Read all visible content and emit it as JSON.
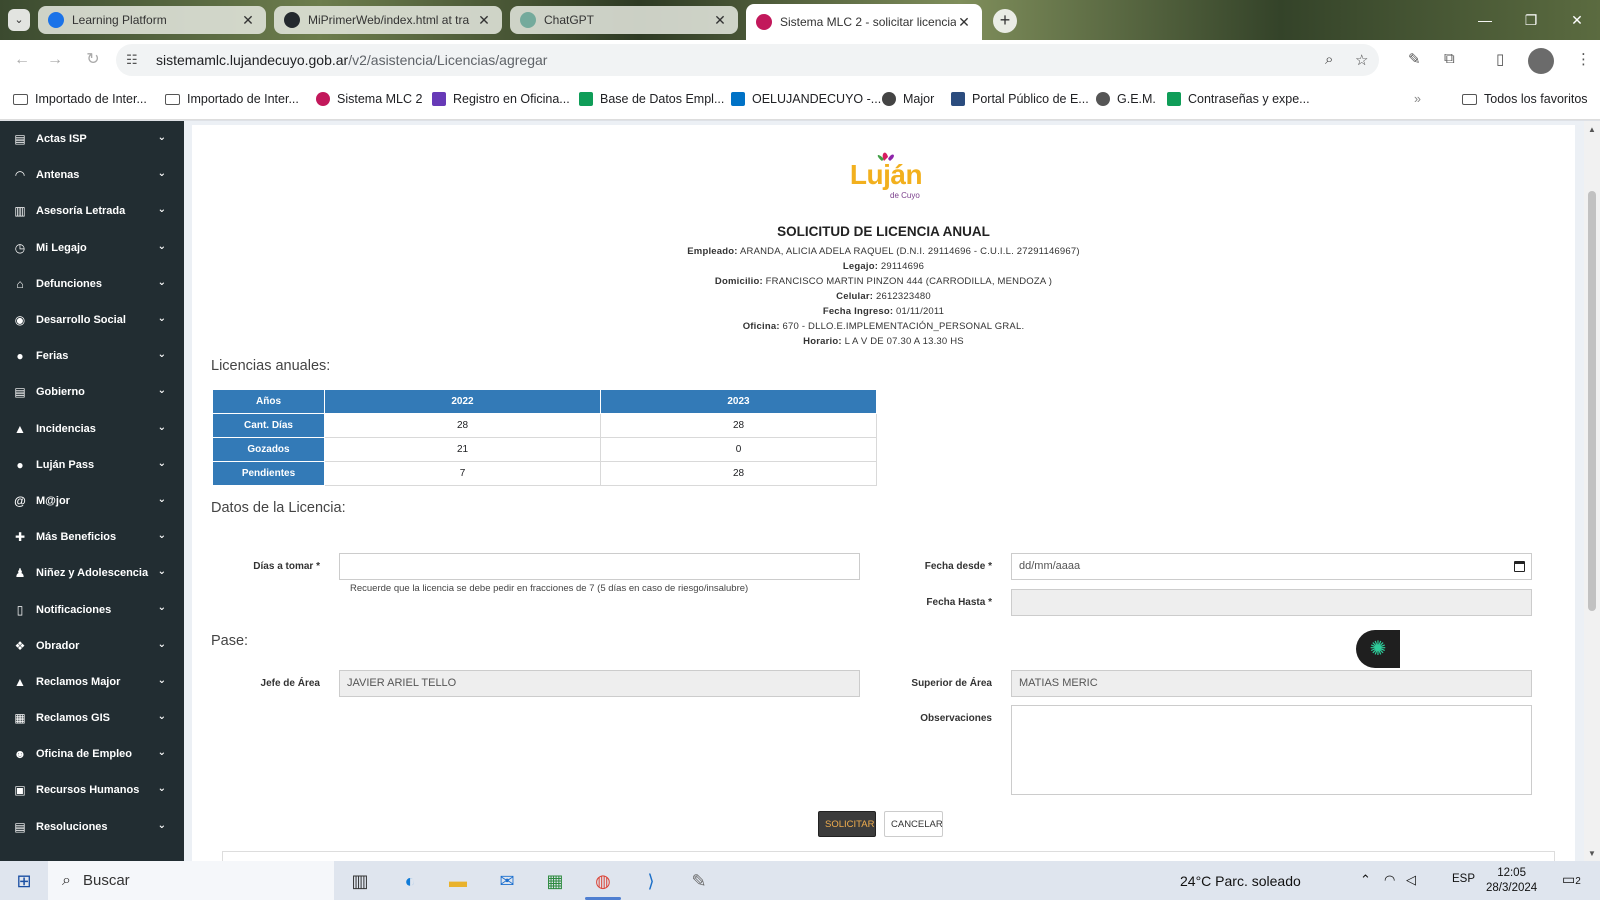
{
  "browser": {
    "tabs": [
      {
        "title": "Learning Platform",
        "color": "#1a73e8"
      },
      {
        "title": "MiPrimerWeb/index.html at tra",
        "color": "#24292e"
      },
      {
        "title": "ChatGPT",
        "color": "#74aa9c"
      },
      {
        "title": "Sistema MLC 2 - solicitar licencia",
        "color": "#c2185b"
      }
    ],
    "url_host": "sistemamlc.lujandecuyo.gob.ar",
    "url_path": "/v2/asistencia/Licencias/agregar",
    "bookmarks": [
      {
        "label": "Importado de Inter...",
        "icon": "folder-icon"
      },
      {
        "label": "Importado de Inter...",
        "icon": "folder-icon"
      },
      {
        "label": "Sistema MLC 2",
        "icon": "mlc-icon"
      },
      {
        "label": "Registro en Oficina...",
        "icon": "form-icon"
      },
      {
        "label": "Base de Datos Empl...",
        "icon": "sheet-icon"
      },
      {
        "label": "OELUJANDECUYO -...",
        "icon": "outlook-icon"
      },
      {
        "label": "Major",
        "icon": "globe-icon"
      },
      {
        "label": "Portal Público de E...",
        "icon": "portal-icon"
      },
      {
        "label": "G.E.M.",
        "icon": "google-icon"
      },
      {
        "label": "Contraseñas y expe...",
        "icon": "sheet-icon"
      }
    ],
    "all_bookmarks": "Todos los favoritos"
  },
  "sidebar": {
    "items": [
      {
        "label": "Actas ISP",
        "icon": "file-icon"
      },
      {
        "label": "Antenas",
        "icon": "wifi-icon"
      },
      {
        "label": "Asesoría Letrada",
        "icon": "book-icon"
      },
      {
        "label": "Mi Legajo",
        "icon": "clock-icon"
      },
      {
        "label": "Defunciones",
        "icon": "bank-icon"
      },
      {
        "label": "Desarrollo Social",
        "icon": "universal-access-icon"
      },
      {
        "label": "Ferias",
        "icon": "map-marker-icon"
      },
      {
        "label": "Gobierno",
        "icon": "document-icon"
      },
      {
        "label": "Incidencias",
        "icon": "warning-icon"
      },
      {
        "label": "Luján Pass",
        "icon": "map-marker-icon"
      },
      {
        "label": "M@jor",
        "icon": "at-icon"
      },
      {
        "label": "Más Beneficios",
        "icon": "plus-icon"
      },
      {
        "label": "Niñez y Adolescencia",
        "icon": "child-icon"
      },
      {
        "label": "Notificaciones",
        "icon": "file-icon"
      },
      {
        "label": "Obrador",
        "icon": "cubes-icon"
      },
      {
        "label": "Reclamos Major",
        "icon": "warning-icon"
      },
      {
        "label": "Reclamos GIS",
        "icon": "map-icon"
      },
      {
        "label": "Oficina de Empleo",
        "icon": "user-icon"
      },
      {
        "label": "Recursos Humanos",
        "icon": "id-card-icon"
      },
      {
        "label": "Resoluciones",
        "icon": "document-icon"
      }
    ]
  },
  "page": {
    "logo_text": "Luján",
    "logo_sub": "de Cuyo",
    "title": "SOLICITUD DE LICENCIA ANUAL",
    "info": [
      {
        "label": "Empleado:",
        "value": "ARANDA, ALICIA ADELA RAQUEL (D.N.I. 29114696 - C.U.I.L. 27291146967)"
      },
      {
        "label": "Legajo:",
        "value": "29114696"
      },
      {
        "label": "Domicilio:",
        "value": "FRANCISCO MARTIN PINZON 444 (CARRODILLA, MENDOZA )"
      },
      {
        "label": "Celular:",
        "value": "2612323480"
      },
      {
        "label": "Fecha Ingreso:",
        "value": "01/11/2011"
      },
      {
        "label": "Oficina:",
        "value": "670 - DLLO.E.IMPLEMENTACIÓN_PERSONAL GRAL."
      },
      {
        "label": "Horario:",
        "value": "L A V DE 07.30 A 13.30 HS"
      }
    ],
    "licencias_title": "Licencias anuales:",
    "table": {
      "headers": [
        "Años",
        "2022",
        "2023"
      ],
      "rows": [
        [
          "Cant. Días",
          "28",
          "28"
        ],
        [
          "Gozados",
          "21",
          "0"
        ],
        [
          "Pendientes",
          "7",
          "28"
        ]
      ]
    },
    "datos_title": "Datos de la Licencia:",
    "dias_label": "Días a tomar *",
    "dias_value": "",
    "dias_help": "Recuerde que la licencia se debe pedir en fracciones de 7 (5 días en caso de riesgo/insalubre)",
    "fecha_desde_label": "Fecha desde *",
    "fecha_desde_placeholder": "dd/mm/aaaa",
    "fecha_hasta_label": "Fecha Hasta *",
    "fecha_hasta_value": "",
    "pase_title": "Pase:",
    "jefe_label": "Jefe de Área",
    "jefe_value": "JAVIER ARIEL TELLO",
    "superior_label": "Superior de Área",
    "superior_value": "MATIAS MERIC",
    "obs_label": "Observaciones",
    "obs_value": "",
    "btn_solicitar": "SOLICITAR",
    "btn_cancelar": "CANCELAR"
  },
  "taskbar": {
    "search_label": "Buscar",
    "weather": "24°C  Parc. soleado",
    "lang": "ESP",
    "time": "12:05",
    "date": "28/3/2024",
    "notifications": "2"
  },
  "colors": {
    "table_header": "#337ab7",
    "sidebar_bg": "#222d32",
    "primary_button_text": "#f0ad4e"
  }
}
